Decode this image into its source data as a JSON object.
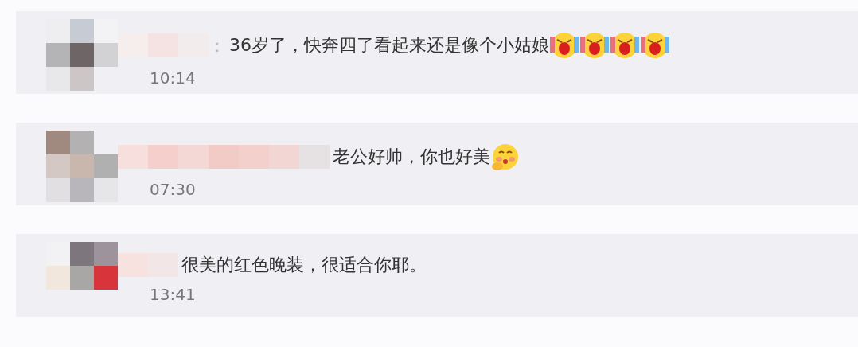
{
  "comments": [
    {
      "separator": "：",
      "text": "36岁了，快奔四了看起来还是像个小姑娘",
      "emojis": [
        {
          "kind": "laugh-cry"
        },
        {
          "kind": "laugh-cry"
        },
        {
          "kind": "laugh-cry"
        },
        {
          "kind": "laugh-cry"
        }
      ],
      "time": "10:14"
    },
    {
      "text": "老公好帅，你也好美",
      "emojis": [
        {
          "kind": "blush"
        }
      ],
      "time": "07:30"
    },
    {
      "text": "很美的红色晚装，很适合你耶。",
      "time": "13:41"
    }
  ]
}
